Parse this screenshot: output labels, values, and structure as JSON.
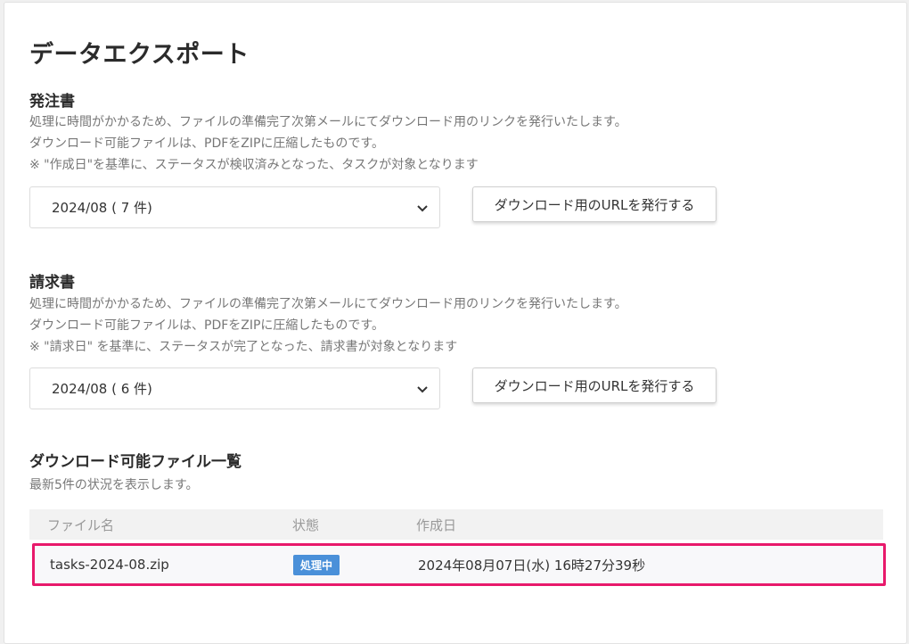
{
  "page": {
    "title": "データエクスポート"
  },
  "order": {
    "title": "発注書",
    "desc1": "処理に時間がかかるため、ファイルの準備完了次第メールにてダウンロード用のリンクを発行いたします。",
    "desc2": "ダウンロード可能ファイルは、PDFをZIPに圧縮したものです。",
    "desc3": "※ \"作成日\"を基準に、ステータスが検収済みとなった、タスクが対象となります",
    "select_value": "2024/08 ( 7 件)",
    "button_label": "ダウンロード用のURLを発行する"
  },
  "invoice": {
    "title": "請求書",
    "desc1": "処理に時間がかかるため、ファイルの準備完了次第メールにてダウンロード用のリンクを発行いたします。",
    "desc2": "ダウンロード可能ファイルは、PDFをZIPに圧縮したものです。",
    "desc3": "※ \"請求日\" を基準に、ステータスが完了となった、請求書が対象となります",
    "select_value": "2024/08 ( 6 件)",
    "button_label": "ダウンロード用のURLを発行する"
  },
  "files": {
    "title": "ダウンロード可能ファイル一覧",
    "subtitle": "最新5件の状況を表示します。",
    "headers": {
      "name": "ファイル名",
      "status": "状態",
      "created": "作成日"
    },
    "rows": [
      {
        "name": "tasks-2024-08.zip",
        "status": "処理中",
        "created": "2024年08月07日(水) 16時27分39秒"
      }
    ]
  },
  "colors": {
    "highlight": "#e8196b",
    "badge": "#4a90d9"
  },
  "icons": {
    "select_chevron": "chevron-down-icon"
  }
}
